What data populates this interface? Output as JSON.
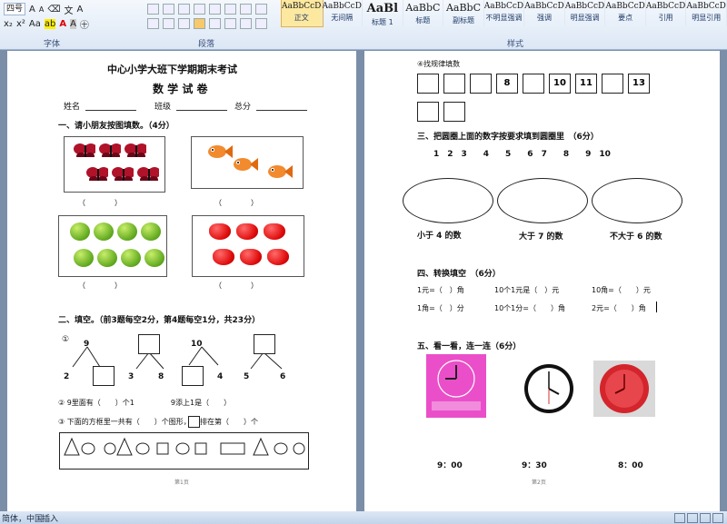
{
  "ribbon": {
    "font_size": "四号",
    "font_group_label": "字体",
    "para_group_label": "段落",
    "styles_group_label": "样式",
    "styles": [
      {
        "sample": "AaBbCcDd",
        "name": "正文",
        "active": true
      },
      {
        "sample": "AaBbCcDd",
        "name": "无间隔"
      },
      {
        "sample": "AaBl",
        "name": "标题 1"
      },
      {
        "sample": "AaBbC",
        "name": "标题"
      },
      {
        "sample": "AaBbC",
        "name": "副标题"
      },
      {
        "sample": "AaBbCcDd",
        "name": "不明显强调"
      },
      {
        "sample": "AaBbCcDd",
        "name": "强调"
      },
      {
        "sample": "AaBbCcDd",
        "name": "明显强调"
      },
      {
        "sample": "AaBbCcD",
        "name": "要点"
      },
      {
        "sample": "AaBbCcDd",
        "name": "引用"
      },
      {
        "sample": "AaBbCcDd",
        "name": "明显引用"
      }
    ]
  },
  "status": {
    "language": "简体，中国",
    "mode": "插入"
  },
  "page1": {
    "title": "中心小学大班下学期期末考试",
    "subtitle": "数 学 试 卷",
    "name_label": "姓名",
    "class_label": "班级",
    "score_label": "总分",
    "q1": "一、请小朋友按图填数。（4分）",
    "paren": "（　　　　）",
    "q2": "二、填空。（前3题每空2分，第4题每空1分，共23分）",
    "circle1": "①",
    "tree_numbers": [
      "9",
      "2",
      "3",
      "8",
      "10",
      "4",
      "5",
      "6"
    ],
    "item2": "② 9里面有（　　）个1　　　　　9添上1是（　　）",
    "item3_a": "③ 下面的方框里一共有（　　）个图形，",
    "item3_b": "排在第（　　）个",
    "footer": "第1页"
  },
  "page2": {
    "item4": "④找规律填数",
    "seq_values": [
      "",
      "",
      "",
      "8",
      "",
      "10",
      "11",
      "",
      "13",
      "",
      ""
    ],
    "q3": "三、把圆圈上面的数字按要求填到圆圈里　（6分）",
    "numbers_row": "1　2　3　　4　　5　　6　7　　8　　9　10",
    "circle_labels": [
      "小于 4 的数",
      "大于 7 的数",
      "不大于 6 的数"
    ],
    "q4": "四、转换填空　（6分）",
    "convert_row1": [
      "1元=（　）角",
      "10个1元是（　）元",
      "10角=（　　）元"
    ],
    "convert_row2": [
      "1角=（　）分",
      "10个1分=（　　）角",
      "2元=（　　）角"
    ],
    "q5": "五、看一看，连一连（6分）",
    "times": [
      "9：00",
      "9：30",
      "8：00"
    ],
    "footer": "第2页"
  }
}
